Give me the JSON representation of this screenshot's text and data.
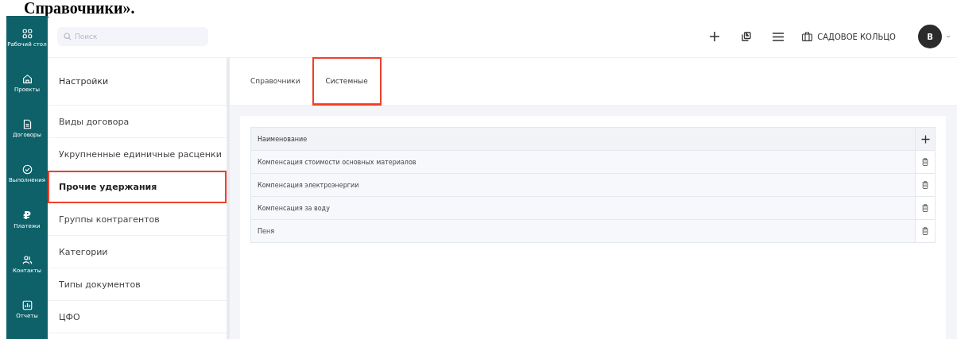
{
  "caption": "Справочники».",
  "rail": [
    {
      "label": "Рабочий стол"
    },
    {
      "label": "Проекты"
    },
    {
      "label": "Договоры"
    },
    {
      "label": "Выполнения"
    },
    {
      "label": "Платежи",
      "icon_char": "₽"
    },
    {
      "label": "Контакты"
    },
    {
      "label": "Отчеты"
    }
  ],
  "search": {
    "placeholder": "Поиск"
  },
  "org": "САДОВОЕ КОЛЬЦО",
  "avatar": "В",
  "settings": {
    "title": "Настройки",
    "items": [
      {
        "label": "Виды договора",
        "selected": false,
        "highlighted": false
      },
      {
        "label": "Укрупненные единичные расценки",
        "selected": false,
        "highlighted": false
      },
      {
        "label": "Прочие удержания",
        "selected": true,
        "highlighted": true
      },
      {
        "label": "Группы контрагентов",
        "selected": false,
        "highlighted": false
      },
      {
        "label": "Категории",
        "selected": false,
        "highlighted": false
      },
      {
        "label": "Типы документов",
        "selected": false,
        "highlighted": false
      },
      {
        "label": "ЦФО",
        "selected": false,
        "highlighted": false
      }
    ]
  },
  "tabs": [
    {
      "label": "Справочники",
      "selected": false,
      "highlighted": false
    },
    {
      "label": "Системные",
      "selected": true,
      "highlighted": true
    }
  ],
  "table": {
    "columns": [
      "Наименование"
    ],
    "rows": [
      {
        "name": "Компенсация стоимости основных материалов"
      },
      {
        "name": "Компенсация  электроэнергии"
      },
      {
        "name": "Компенсация за воду"
      },
      {
        "name": "Пеня"
      }
    ]
  }
}
